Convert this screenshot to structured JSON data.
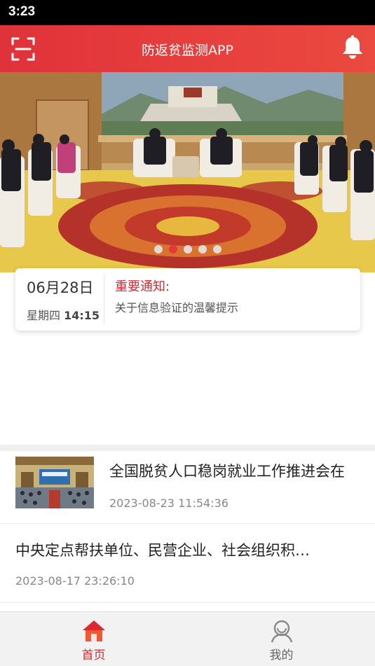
{
  "status_bar": {
    "time": "3:23"
  },
  "header": {
    "title": "防返贫监测APP",
    "scan_icon": "scan-icon",
    "bell_icon": "bell-icon"
  },
  "banner": {
    "dots_total": 5,
    "active_dot": 2
  },
  "notice": {
    "date": "06月28日",
    "weekday": "星期四",
    "time": "14:15",
    "title": "重要通知:",
    "text": "关于信息验证的温馨提示"
  },
  "news": [
    {
      "title": "全国脱贫人口稳岗就业工作推进会在",
      "date": "2023-08-23 11:54:36"
    },
    {
      "title": "中央定点帮扶单位、民营企业、社会组织积…",
      "date": "2023-08-17 23:26:10"
    }
  ],
  "tabs": [
    {
      "label": "首页",
      "icon": "home-icon"
    },
    {
      "label": "我的",
      "icon": "user-icon"
    }
  ],
  "colors": {
    "accent": "#e0262e",
    "header": "#e43a3c"
  }
}
